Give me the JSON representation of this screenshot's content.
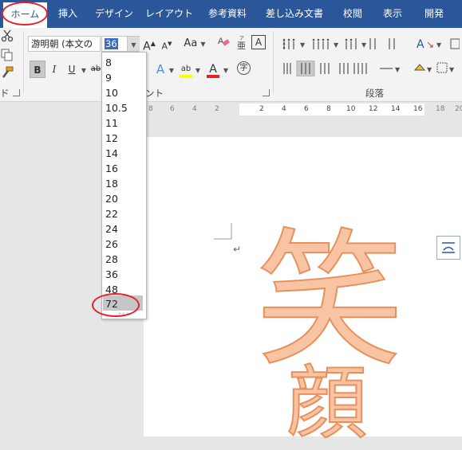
{
  "tabs": [
    {
      "label": "ホーム",
      "active": true
    },
    {
      "label": "挿入"
    },
    {
      "label": "デザイン"
    },
    {
      "label": "レイアウト"
    },
    {
      "label": "参考資料"
    },
    {
      "label": "差し込み文書"
    },
    {
      "label": "校閲"
    },
    {
      "label": "表示"
    },
    {
      "label": "開発"
    }
  ],
  "font": {
    "name": "游明朝 (本文の",
    "size": "36",
    "grow_label": "A",
    "shrink_label": "A",
    "case_label": "Aa",
    "bold": "B",
    "italic": "I",
    "underline": "U",
    "strike": "ab",
    "effect": "A",
    "highlight": "ab",
    "color": "A",
    "enclose": "字",
    "group_label": "ント",
    "highlight_color": "#ffff00",
    "font_color": "#e8202a"
  },
  "clipboard": {
    "group_label": "ド"
  },
  "paragraph": {
    "group_label": "段落"
  },
  "ruler": {
    "left_ticks": [
      "8",
      "6",
      "4",
      "2"
    ],
    "right_ticks": [
      "2",
      "4",
      "6",
      "8",
      "10",
      "12",
      "14",
      "16",
      "18",
      "20"
    ]
  },
  "font_size_dropdown": {
    "options": [
      "8",
      "9",
      "10",
      "10.5",
      "11",
      "12",
      "14",
      "16",
      "18",
      "20",
      "22",
      "24",
      "26",
      "28",
      "36",
      "48",
      "72"
    ],
    "highlighted": "72"
  },
  "document": {
    "line1": "笑",
    "line2": "顔",
    "paragraph_mark": "↵",
    "text_color": "#f8c4a4",
    "outline_color": "#e8905c"
  },
  "colors": {
    "ribbon_blue": "#2b579a",
    "annotation_red": "#e8202a"
  }
}
